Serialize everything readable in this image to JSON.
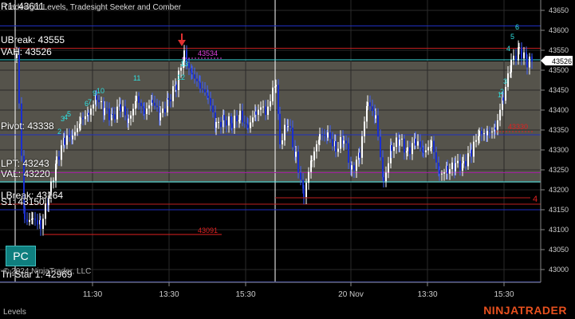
{
  "window": {
    "title": "Tradesight Levels, Tradesight Seeker and Comber",
    "copyright": "© 2024 NinjaTrader, LLC",
    "bottom_label": "Levels",
    "brand": "NINJATRADER",
    "pc_button": "PC"
  },
  "levels": [
    {
      "label": "R1: 43611",
      "value": 43611,
      "color": "#2030c0"
    },
    {
      "label": "UBreak: 43555",
      "value": 43555,
      "color": "#c02020"
    },
    {
      "label": "VAH: 43526",
      "value": 43526,
      "color": "#40e0e0"
    },
    {
      "label": "Pivot: 43338",
      "value": 43338,
      "color": "#2030c0"
    },
    {
      "label": "LPT: 43243",
      "value": 43243,
      "color": "#a020a0"
    },
    {
      "label": "VAL: 43220",
      "value": 43220,
      "color": "#40e0e0"
    },
    {
      "label": "LBreak: 43164",
      "value": 43164,
      "color": "#c02020"
    },
    {
      "label": "S1: 43150",
      "value": 43150,
      "color": "#2030c0"
    },
    {
      "label": "Tri-Star 1: 42969",
      "value": 42969,
      "color": "#2030c0"
    }
  ],
  "annotations": [
    {
      "text": "43534",
      "color": "#e040e0"
    },
    {
      "text": "43330",
      "color": "#e02020"
    },
    {
      "text": "43091",
      "color": "#e02020"
    },
    {
      "text": "4",
      "color": "#e02020"
    }
  ],
  "price_axis": {
    "ticks": [
      "43650",
      "43600",
      "43550",
      "43500",
      "43450",
      "43400",
      "43350",
      "43300",
      "43250",
      "43200",
      "43150",
      "43100",
      "43050",
      "43000"
    ],
    "current_price": "43526"
  },
  "time_axis": {
    "ticks": [
      "11:30",
      "13:30",
      "15:30",
      "20 Nov",
      "13:30",
      "15:30"
    ]
  },
  "seeker_labels": [
    "1",
    "2",
    "3",
    "4",
    "5",
    "6",
    "7",
    "8",
    "9",
    "10",
    "11",
    "12",
    "13"
  ],
  "chart_data": {
    "type": "candlestick",
    "ylim": [
      42960,
      43670
    ],
    "bars_description": "Intraday 5-minute bars across two sessions",
    "colors": {
      "up": "#ffffff",
      "down": "#1a2fd0",
      "value_area": "#5a5850"
    }
  }
}
